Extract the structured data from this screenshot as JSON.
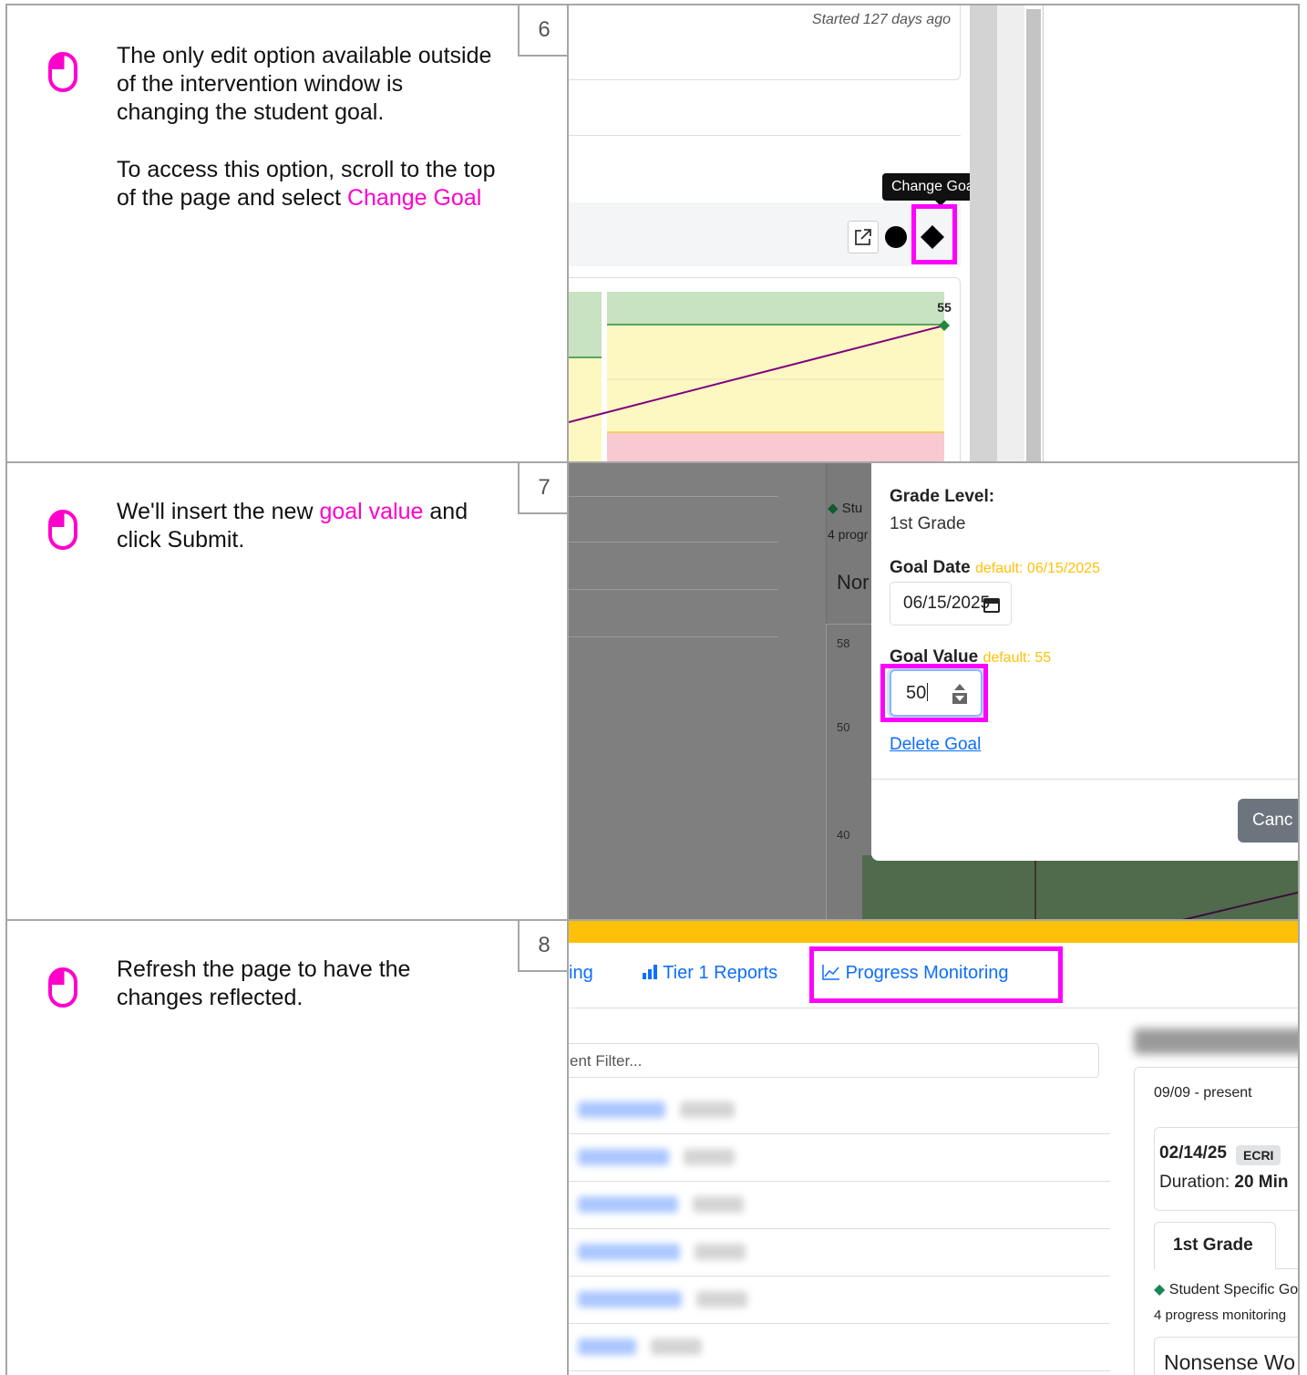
{
  "steps": [
    {
      "number": "6",
      "paragraphs": [
        {
          "text": "The only edit option available outside of the intervention window is changing the student goal."
        },
        {
          "pre": "To access this option, scroll to the top of the page and select ",
          "highlight": "Change Goal",
          "post": ""
        }
      ]
    },
    {
      "number": "7",
      "paragraphs": [
        {
          "pre": "We'll insert the new ",
          "highlight": "goal value",
          "post": " and click Submit."
        }
      ]
    },
    {
      "number": "8",
      "paragraphs": [
        {
          "text": "Refresh the page to have the changes reflected."
        }
      ]
    }
  ],
  "shot6": {
    "started_text": "Started 127 days ago",
    "tooltip": "Change Goal",
    "goal_marker_label": "55",
    "icons": [
      "external-link-icon",
      "circle-icon",
      "diamond-icon"
    ]
  },
  "shot7": {
    "bg_marker": "Stu",
    "bg_progress": "4 progr",
    "bg_heading": "Nor",
    "bg_ticks": [
      "58",
      "50",
      "40"
    ],
    "grade_level_label": "Grade Level:",
    "grade_level_value": "1st Grade",
    "goal_date_label": "Goal Date",
    "goal_date_default": "default: 06/15/2025",
    "goal_date_value": "06/15/2025",
    "goal_value_label": "Goal Value",
    "goal_value_default": "default: 55",
    "goal_value_input": "50",
    "delete_link": "Delete Goal",
    "cancel_button": "Canc",
    "colors": {
      "highlight": "#ff00ff",
      "default_hint": "#ffc107",
      "link": "#0d6efd"
    }
  },
  "shot8": {
    "tab_partial": "ing",
    "tab_tier1": "Tier 1 Reports",
    "tab_pm": "Progress Monitoring",
    "filter_placeholder": "ent Filter...",
    "period": "09/09 - present",
    "session_date": "02/14/25",
    "session_badge": "ECRI",
    "duration_label": "Duration: ",
    "duration_value": "20 Min",
    "grade_tab": "1st Grade",
    "goal_legend": "Student Specific Go",
    "pm_text": "4 progress monitoring",
    "nonsense": "Nonsense Wo",
    "colors": {
      "banner": "#ffc107",
      "tab": "#0d6efd"
    }
  }
}
